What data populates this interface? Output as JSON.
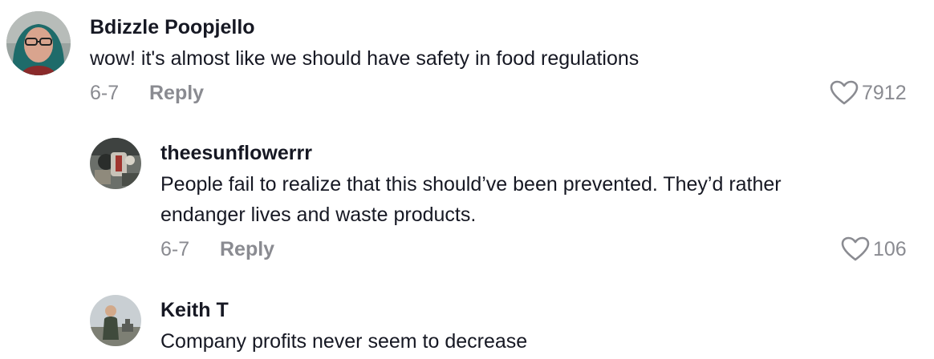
{
  "comments": [
    {
      "username": "Bdizzle Poopjello",
      "text": "wow! it's almost like we should have safety in food regulations",
      "date": "6-7",
      "reply_label": "Reply",
      "likes": "7912",
      "avatar_icon": "user-avatar-icon"
    },
    {
      "username": "theesunflowerrr",
      "text_line1": "People fail to realize that this should’ve been prevented. They’d rather",
      "text_line2": "endanger lives and waste products.",
      "date": "6-7",
      "reply_label": "Reply",
      "likes": "106",
      "avatar_icon": "user-avatar-icon"
    },
    {
      "username": "Keith T",
      "text": "Company profits never seem to decrease",
      "avatar_icon": "user-avatar-icon"
    }
  ],
  "colors": {
    "text": "#161823",
    "muted": "#8a8b91"
  }
}
